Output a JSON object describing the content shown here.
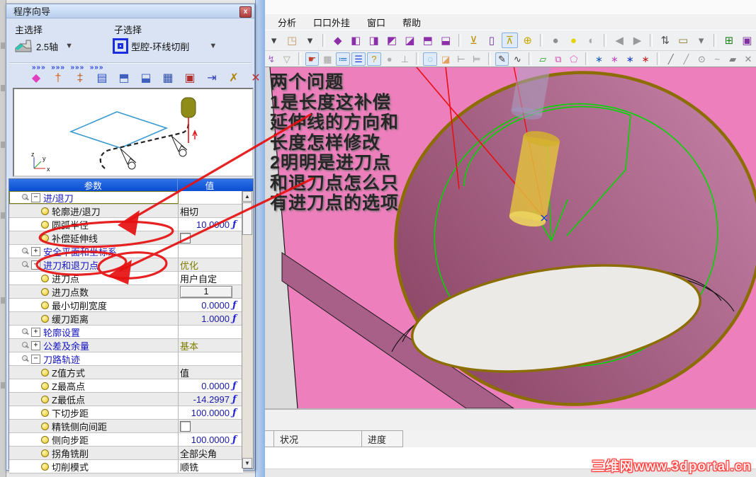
{
  "dialog": {
    "title": "程序向导",
    "close_label": "x",
    "main_select_label": "主选择",
    "sub_select_label": "子选择",
    "main_select_value": "2.5轴",
    "sub_select_value": "型腔-环线切削",
    "toolbar_icons": [
      {
        "name": "wizard-edit-geometry-icon",
        "glyph": "◆",
        "color": "#e040c0"
      },
      {
        "name": "wizard-tool-icon",
        "glyph": "†",
        "color": "#e06010"
      },
      {
        "name": "wizard-tool-table-icon",
        "glyph": "‡",
        "color": "#c05818"
      },
      {
        "name": "wizard-machine-params-icon",
        "glyph": "▤",
        "color": "#3050c0"
      },
      {
        "name": "wizard-preview-icon",
        "glyph": "⬒",
        "color": "#4060c0"
      },
      {
        "name": "wizard-simulate-icon",
        "glyph": "⬓",
        "color": "#4060c0"
      },
      {
        "name": "wizard-view-params-icon",
        "glyph": "▦",
        "color": "#3050b0"
      },
      {
        "name": "wizard-save-icon",
        "glyph": "▣",
        "color": "#b03030"
      },
      {
        "name": "wizard-save-exit-icon",
        "glyph": "⇥",
        "color": "#3040c0"
      },
      {
        "name": "wizard-apply-exit-icon",
        "glyph": "✗",
        "color": "#b08000"
      },
      {
        "name": "wizard-exit-icon",
        "glyph": "✕",
        "color": "#c03030"
      }
    ],
    "param_table": {
      "headers": [
        "参数",
        "值"
      ],
      "rows": [
        {
          "label": "进/退刀",
          "type": "group",
          "expanded": true,
          "value": "",
          "vtype": "none",
          "selected": true
        },
        {
          "label": "轮廓进/退刀",
          "type": "leaf",
          "value": "相切",
          "vtype": "text"
        },
        {
          "label": "圆弧半径",
          "type": "leaf",
          "value": "10.0000",
          "vtype": "numf"
        },
        {
          "label": "补偿延伸线",
          "type": "leaf",
          "value": "",
          "vtype": "check"
        },
        {
          "label": "安全平面和坐标系",
          "type": "group",
          "expanded": false,
          "value": "",
          "vtype": "none"
        },
        {
          "label": "进刀和退刀点",
          "type": "group",
          "expanded": true,
          "value": "优化",
          "vtype": "olive"
        },
        {
          "label": "进刀点",
          "type": "leaf",
          "value": "用户自定",
          "vtype": "text"
        },
        {
          "label": "进刀点数",
          "type": "leaf",
          "value": "1",
          "vtype": "btn"
        },
        {
          "label": "最小切削宽度",
          "type": "leaf",
          "value": "0.0000",
          "vtype": "numf"
        },
        {
          "label": "缓刀距离",
          "type": "leaf",
          "value": "1.0000",
          "vtype": "numf"
        },
        {
          "label": "轮廓设置",
          "type": "group",
          "expanded": false,
          "value": "",
          "vtype": "none"
        },
        {
          "label": "公差及余量",
          "type": "group",
          "expanded": false,
          "value": "基本",
          "vtype": "olive"
        },
        {
          "label": "刀路轨迹",
          "type": "group",
          "expanded": true,
          "value": "",
          "vtype": "none"
        },
        {
          "label": "Z值方式",
          "type": "leaf",
          "value": "值",
          "vtype": "text"
        },
        {
          "label": "Z最高点",
          "type": "leaf",
          "value": "0.0000",
          "vtype": "numf"
        },
        {
          "label": "Z最低点",
          "type": "leaf",
          "value": "-14.2997",
          "vtype": "numf"
        },
        {
          "label": "下切步距",
          "type": "leaf",
          "value": "100.0000",
          "vtype": "numf"
        },
        {
          "label": "精铣侧向间距",
          "type": "leaf",
          "value": "",
          "vtype": "check"
        },
        {
          "label": "侧向步距",
          "type": "leaf",
          "value": "100.0000",
          "vtype": "numf"
        },
        {
          "label": "拐角铣削",
          "type": "leaf",
          "value": "全部尖角",
          "vtype": "text"
        },
        {
          "label": "切削模式",
          "type": "leaf",
          "value": "顺铣",
          "vtype": "text"
        }
      ]
    }
  },
  "menu": {
    "items": [
      "分析",
      "口口外挂",
      "窗口",
      "帮助"
    ]
  },
  "toolbar1_icons": [
    {
      "name": "orient-arrow-icon",
      "glyph": "▾",
      "color": "#444"
    },
    {
      "name": "orient-cube-icon",
      "glyph": "◳",
      "color": "#c09a60"
    },
    {
      "name": "orient-arrow2-icon",
      "glyph": "▾",
      "color": "#444"
    },
    {
      "sep": true
    },
    {
      "name": "view-iso-cube-icon",
      "glyph": "◆",
      "color": "#8c2fa8"
    },
    {
      "name": "view-front-cube-icon",
      "glyph": "◧",
      "color": "#8c2fa8"
    },
    {
      "name": "view-back-cube-icon",
      "glyph": "◨",
      "color": "#8c2fa8"
    },
    {
      "name": "view-left-cube-icon",
      "glyph": "◩",
      "color": "#8c2fa8"
    },
    {
      "name": "view-right-cube-icon",
      "glyph": "◪",
      "color": "#8c2fa8"
    },
    {
      "name": "view-top-cube-icon",
      "glyph": "⬒",
      "color": "#8c2fa8"
    },
    {
      "name": "view-bottom-cube-icon",
      "glyph": "⬓",
      "color": "#8c2fa8"
    },
    {
      "sep": true
    },
    {
      "name": "tool-display-icon",
      "glyph": "⊻",
      "color": "#c09000"
    },
    {
      "name": "tool-wire-icon",
      "glyph": "▯",
      "color": "#7030a0"
    },
    {
      "name": "tool-holder-icon",
      "glyph": "⊼",
      "color": "#c0a000",
      "active": true
    },
    {
      "name": "tool-tip-icon",
      "glyph": "⊕",
      "color": "#c8a800"
    },
    {
      "sep": true
    },
    {
      "name": "lamp-off-icon",
      "glyph": "●",
      "color": "#8f8f8f"
    },
    {
      "name": "lamp-on-icon",
      "glyph": "●",
      "color": "#e6d200"
    },
    {
      "name": "lamp-pick-icon",
      "glyph": "◐",
      "color": "#a8a8a8"
    },
    {
      "sep": true
    },
    {
      "name": "back-icon",
      "glyph": "◀",
      "color": "#9a9a9a"
    },
    {
      "name": "forward-icon",
      "glyph": "▶",
      "color": "#9a9a9a"
    },
    {
      "sep": true
    },
    {
      "name": "swap-points-icon",
      "glyph": "⇅",
      "color": "#505050"
    },
    {
      "name": "measure-icon",
      "glyph": "▭",
      "color": "#8a7a30"
    },
    {
      "name": "snap-dropdown-icon",
      "glyph": "▾",
      "color": "#777"
    },
    {
      "sep": true
    },
    {
      "name": "new-process-icon",
      "glyph": "⊞",
      "color": "#208020"
    },
    {
      "name": "stock-cube-icon",
      "glyph": "▣",
      "color": "#8030a0"
    }
  ],
  "toolbar2_icons": [
    {
      "name": "trace-filter-icon",
      "glyph": "↯",
      "color": "#a060c8"
    },
    {
      "name": "funnel-filter-icon",
      "glyph": "▽",
      "color": "#a8a090"
    },
    {
      "sep": true
    },
    {
      "name": "pick-hand-icon",
      "glyph": "☛",
      "color": "#c04030",
      "active": true
    },
    {
      "name": "pick-grid-icon",
      "glyph": "▦",
      "color": "#a0a0a0"
    },
    {
      "name": "display-list-icon",
      "glyph": "≔",
      "color": "#2070c0",
      "active": true
    },
    {
      "name": "display-lines-icon",
      "glyph": "☰",
      "color": "#2040d0",
      "active": true
    },
    {
      "name": "help-icon",
      "glyph": "?",
      "color": "#b89800",
      "active": true
    },
    {
      "name": "dot-icon",
      "glyph": "●",
      "color": "#b3b3b3"
    },
    {
      "name": "tool-axis-icon",
      "glyph": "⊥",
      "color": "#a0a0a0"
    },
    {
      "sep": true
    },
    {
      "name": "uv-points-icon",
      "glyph": "◌",
      "color": "#30a8c0",
      "active": true
    },
    {
      "name": "corner-solid-icon",
      "glyph": "◪",
      "color": "#e0a060"
    },
    {
      "name": "dim-h-icon",
      "glyph": "⊢",
      "color": "#909090"
    },
    {
      "name": "dim-v-icon",
      "glyph": "⊨",
      "color": "#909090"
    },
    {
      "sep": true
    },
    {
      "name": "sketch-edit-icon",
      "glyph": "✎",
      "color": "#303030",
      "active": true
    },
    {
      "name": "curve-pick-icon",
      "glyph": "∿",
      "color": "#404040"
    },
    {
      "sep": true
    },
    {
      "name": "plane-green-icon",
      "glyph": "▱",
      "color": "#20a020"
    },
    {
      "name": "surface-fold-icon",
      "glyph": "⧉",
      "color": "#d050b0"
    },
    {
      "name": "surface-lasso-icon",
      "glyph": "⬠",
      "color": "#e060c0"
    },
    {
      "sep": true
    },
    {
      "name": "csys-model-icon",
      "glyph": "∗",
      "color": "#2060c0"
    },
    {
      "name": "csys-plane-icon",
      "glyph": "∗",
      "color": "#c050c0"
    },
    {
      "name": "csys-move-icon",
      "glyph": "∗",
      "color": "#2040c0"
    },
    {
      "name": "csys-active-icon",
      "glyph": "∗",
      "color": "#c02020"
    },
    {
      "sep": true
    },
    {
      "name": "line-icon",
      "glyph": "╱",
      "color": "#707070"
    },
    {
      "name": "line2-icon",
      "glyph": "╱",
      "color": "#9a9a9a"
    },
    {
      "name": "circle-icon",
      "glyph": "⊙",
      "color": "#909090"
    },
    {
      "name": "spline-icon",
      "glyph": "~",
      "color": "#909090"
    },
    {
      "name": "plane-gray-icon",
      "glyph": "▰",
      "color": "#808080"
    },
    {
      "name": "delete-icon",
      "glyph": "✕",
      "color": "#8a8a8a"
    }
  ],
  "annotation": {
    "lines": [
      "两个问题",
      "1是长度这补偿",
      "延伸线的方向和",
      "长度怎样修改",
      "2明明是进刀点",
      "和退刀点怎么只",
      "有进刀点的选项"
    ]
  },
  "statusbar": {
    "columns": [
      "状况",
      "进度"
    ]
  },
  "watermark": {
    "text": "三维网www.3dportal.cn"
  },
  "colors": {
    "accent_red": "#e61010",
    "pink_face": "#ee7fbd",
    "pocket_dark": "#8d4868",
    "pocket_light": "#c27fa4",
    "rim_olive": "#8b6d00",
    "toolpath_green": "#00d800",
    "tool_yellow": "#e3c33c",
    "header_blue": "#0b4ed2"
  }
}
